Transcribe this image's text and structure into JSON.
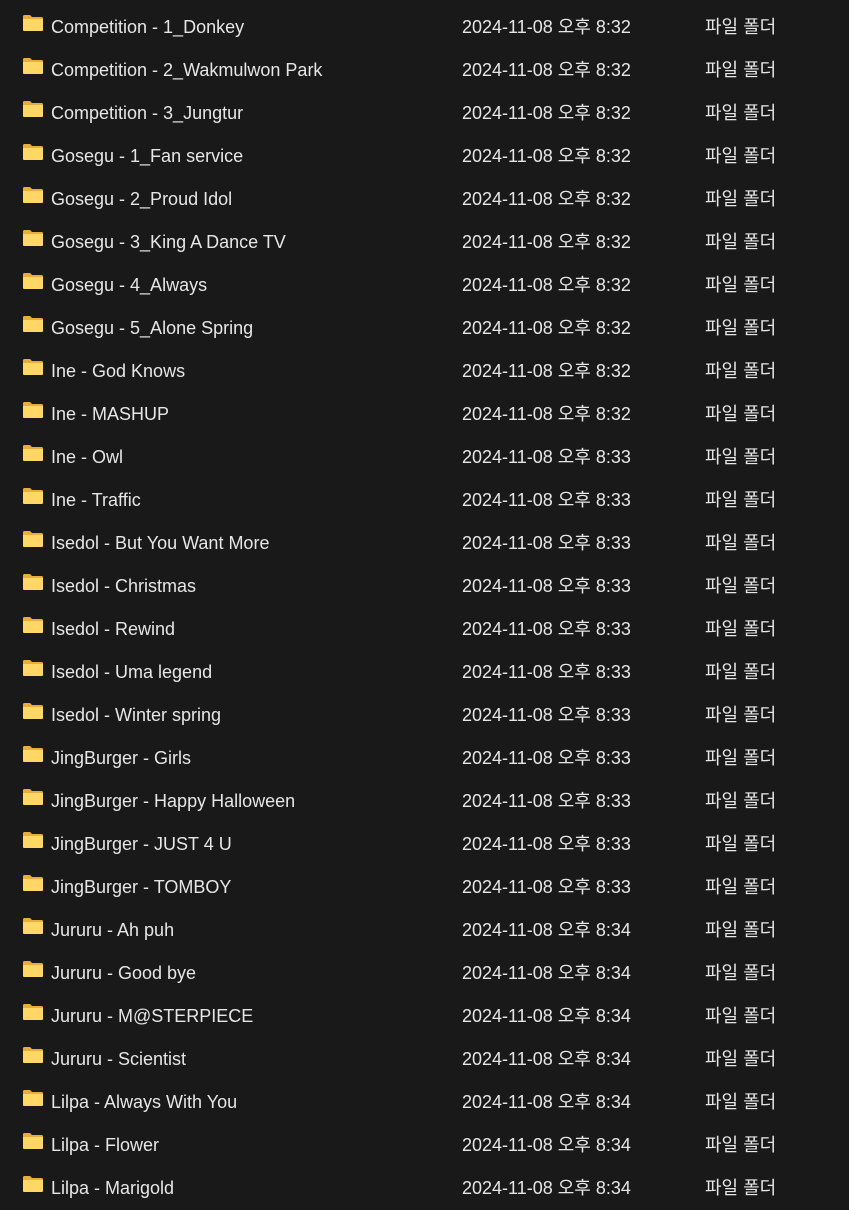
{
  "colors": {
    "background": "#191919",
    "text": "#e6e6e6",
    "folder_front": "#ffd766",
    "folder_back": "#e8ad3a"
  },
  "icon": "folder-icon",
  "rows": [
    {
      "name": "Competition - 1_Donkey",
      "modified": "2024-11-08 오후 8:32",
      "type": "파일 폴더"
    },
    {
      "name": "Competition - 2_Wakmulwon Park",
      "modified": "2024-11-08 오후 8:32",
      "type": "파일 폴더"
    },
    {
      "name": "Competition - 3_Jungtur",
      "modified": "2024-11-08 오후 8:32",
      "type": "파일 폴더"
    },
    {
      "name": "Gosegu - 1_Fan service",
      "modified": "2024-11-08 오후 8:32",
      "type": "파일 폴더"
    },
    {
      "name": "Gosegu - 2_Proud Idol",
      "modified": "2024-11-08 오후 8:32",
      "type": "파일 폴더"
    },
    {
      "name": "Gosegu - 3_King A Dance TV",
      "modified": "2024-11-08 오후 8:32",
      "type": "파일 폴더"
    },
    {
      "name": "Gosegu - 4_Always",
      "modified": "2024-11-08 오후 8:32",
      "type": "파일 폴더"
    },
    {
      "name": "Gosegu - 5_Alone Spring",
      "modified": "2024-11-08 오후 8:32",
      "type": "파일 폴더"
    },
    {
      "name": "Ine - God Knows",
      "modified": "2024-11-08 오후 8:32",
      "type": "파일 폴더"
    },
    {
      "name": "Ine - MASHUP",
      "modified": "2024-11-08 오후 8:32",
      "type": "파일 폴더"
    },
    {
      "name": "Ine - Owl",
      "modified": "2024-11-08 오후 8:33",
      "type": "파일 폴더"
    },
    {
      "name": "Ine - Traffic",
      "modified": "2024-11-08 오후 8:33",
      "type": "파일 폴더"
    },
    {
      "name": "Isedol - But You Want More",
      "modified": "2024-11-08 오후 8:33",
      "type": "파일 폴더"
    },
    {
      "name": "Isedol - Christmas",
      "modified": "2024-11-08 오후 8:33",
      "type": "파일 폴더"
    },
    {
      "name": "Isedol - Rewind",
      "modified": "2024-11-08 오후 8:33",
      "type": "파일 폴더"
    },
    {
      "name": "Isedol - Uma legend",
      "modified": "2024-11-08 오후 8:33",
      "type": "파일 폴더"
    },
    {
      "name": "Isedol - Winter spring",
      "modified": "2024-11-08 오후 8:33",
      "type": "파일 폴더"
    },
    {
      "name": "JingBurger - Girls",
      "modified": "2024-11-08 오후 8:33",
      "type": "파일 폴더"
    },
    {
      "name": "JingBurger - Happy Halloween",
      "modified": "2024-11-08 오후 8:33",
      "type": "파일 폴더"
    },
    {
      "name": "JingBurger - JUST 4 U",
      "modified": "2024-11-08 오후 8:33",
      "type": "파일 폴더"
    },
    {
      "name": "JingBurger - TOMBOY",
      "modified": "2024-11-08 오후 8:33",
      "type": "파일 폴더"
    },
    {
      "name": "Jururu - Ah puh",
      "modified": "2024-11-08 오후 8:34",
      "type": "파일 폴더"
    },
    {
      "name": "Jururu - Good bye",
      "modified": "2024-11-08 오후 8:34",
      "type": "파일 폴더"
    },
    {
      "name": "Jururu - M@STERPIECE",
      "modified": "2024-11-08 오후 8:34",
      "type": "파일 폴더"
    },
    {
      "name": "Jururu - Scientist",
      "modified": "2024-11-08 오후 8:34",
      "type": "파일 폴더"
    },
    {
      "name": "Lilpa - Always With You",
      "modified": "2024-11-08 오후 8:34",
      "type": "파일 폴더"
    },
    {
      "name": "Lilpa - Flower",
      "modified": "2024-11-08 오후 8:34",
      "type": "파일 폴더"
    },
    {
      "name": "Lilpa - Marigold",
      "modified": "2024-11-08 오후 8:34",
      "type": "파일 폴더"
    }
  ]
}
